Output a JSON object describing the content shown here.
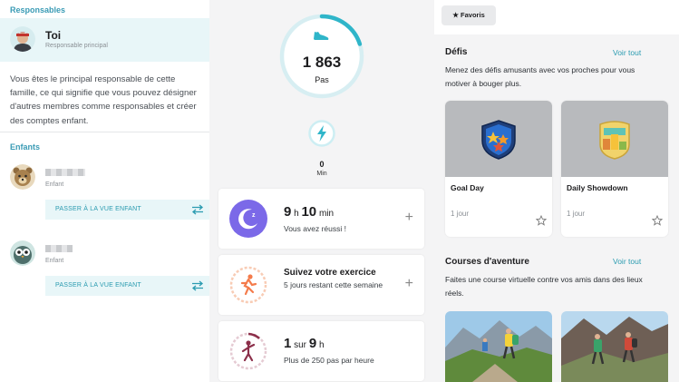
{
  "family": {
    "owners_title": "Responsables",
    "owner": {
      "name": "Toi",
      "role": "Responsable principal"
    },
    "description": "Vous êtes le principal responsable de cette famille, ce qui signifie que vous pouvez désigner d'autres membres comme responsables et créer des comptes enfant.",
    "children_title": "Enfants",
    "children": [
      {
        "role": "Enfant",
        "button_label": "PASSER À LA VUE ENFANT",
        "avatar_icon": "bear-avatar-icon"
      },
      {
        "role": "Enfant",
        "button_label": "PASSER À LA VUE ENFANT",
        "avatar_icon": "owl-avatar-icon"
      }
    ]
  },
  "today": {
    "steps": {
      "value": "1 863",
      "label": "Pas",
      "progress": 0.2,
      "icon": "shoe-icon"
    },
    "active_minutes": {
      "value": "0",
      "label": "Min",
      "icon": "bolt-icon"
    },
    "sleep": {
      "hours": "9",
      "h_unit": "h",
      "minutes": "10",
      "min_unit": "min",
      "status": "Vous avez réussi !",
      "icon": "moon-icon"
    },
    "exercise": {
      "title": "Suivez votre exercice",
      "subtitle": "5 jours restant cette semaine",
      "icon": "runner-icon"
    },
    "hourly": {
      "done": "1",
      "sur": "sur",
      "total": "9",
      "unit": "h",
      "subtitle": "Plus de 250 pas par heure",
      "icon": "walker-icon"
    }
  },
  "discover": {
    "favorites_chip": "★ Favoris",
    "challenges": {
      "title": "Défis",
      "see_all": "Voir tout",
      "description": "Menez des défis amusants avec vos proches pour vous motiver à bouger plus.",
      "items": [
        {
          "name": "Goal Day",
          "duration": "1 jour",
          "icon": "shield-stars-badge-icon"
        },
        {
          "name": "Daily Showdown",
          "duration": "1 jour",
          "icon": "podium-badge-icon"
        }
      ]
    },
    "adventures": {
      "title": "Courses d'aventure",
      "see_all": "Voir tout",
      "description": "Faites une course virtuelle contre vos amis dans des lieux réels."
    }
  },
  "colors": {
    "teal": "#2a9bb0",
    "teal_light": "#e8f6f8",
    "sleep_purple": "#7b69e8",
    "exercise_orange": "#f47b4b",
    "hourly_maroon": "#8c2f4a"
  }
}
